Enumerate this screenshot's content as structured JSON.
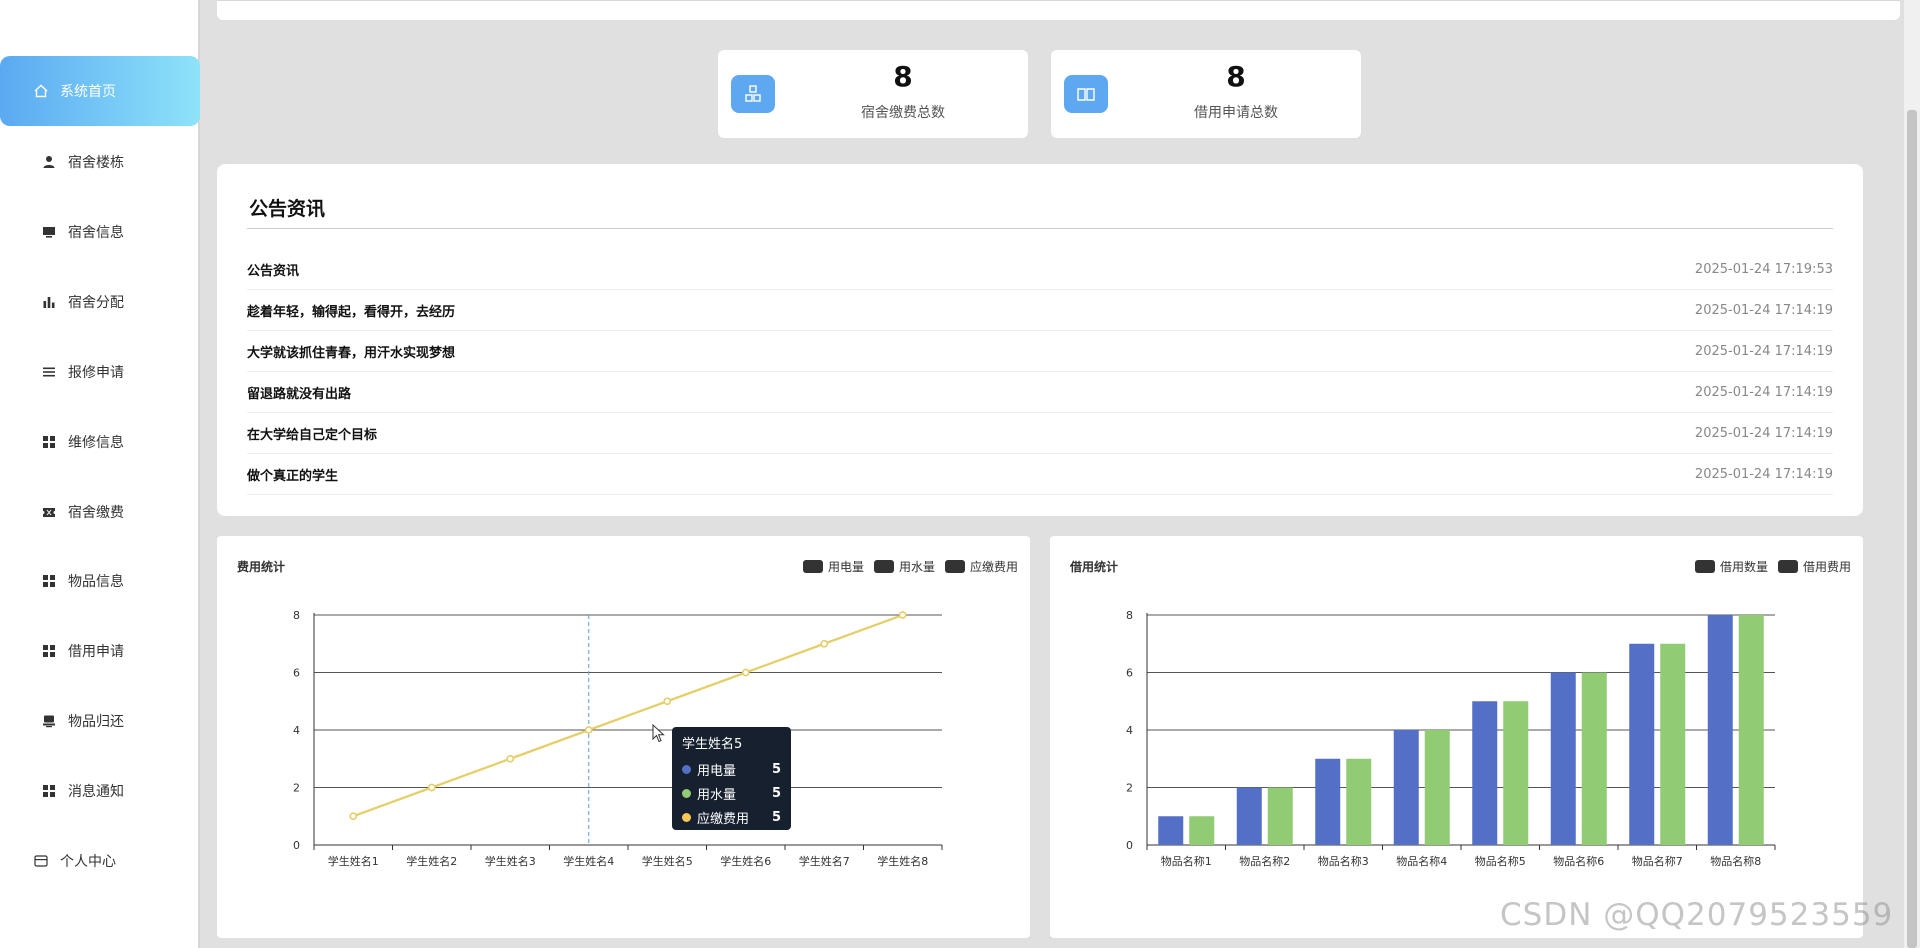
{
  "sidebar": {
    "items": [
      {
        "label": "系统首页",
        "icon": "home-icon"
      },
      {
        "label": "宿舍楼栋",
        "icon": "user-icon"
      },
      {
        "label": "宿舍信息",
        "icon": "monitor-icon"
      },
      {
        "label": "宿舍分配",
        "icon": "bar-chart-icon"
      },
      {
        "label": "报修申请",
        "icon": "list-icon"
      },
      {
        "label": "维修信息",
        "icon": "grid-icon"
      },
      {
        "label": "宿舍缴费",
        "icon": "ticket-icon"
      },
      {
        "label": "物品信息",
        "icon": "grid-icon"
      },
      {
        "label": "借用申请",
        "icon": "grid-icon"
      },
      {
        "label": "物品归还",
        "icon": "printer-icon"
      },
      {
        "label": "消息通知",
        "icon": "grid-icon"
      },
      {
        "label": "个人中心",
        "icon": "card-icon"
      }
    ]
  },
  "stats": [
    {
      "value": "8",
      "label": "宿舍缴费总数",
      "icon": "building-blocks-icon"
    },
    {
      "value": "8",
      "label": "借用申请总数",
      "icon": "book-icon"
    }
  ],
  "notices": {
    "title": "公告资讯",
    "items": [
      {
        "text": "公告资讯",
        "time": "2025-01-24 17:19:53"
      },
      {
        "text": "趁着年轻，输得起，看得开，去经历",
        "time": "2025-01-24 17:14:19"
      },
      {
        "text": "大学就该抓住青春，用汗水实现梦想",
        "time": "2025-01-24 17:14:19"
      },
      {
        "text": "留退路就没有出路",
        "time": "2025-01-24 17:14:19"
      },
      {
        "text": "在大学给自己定个目标",
        "time": "2025-01-24 17:14:19"
      },
      {
        "text": "做个真正的学生",
        "time": "2025-01-24 17:14:19"
      }
    ]
  },
  "colors": {
    "accent": "#5ea8f2",
    "series_blue": "#5470c6",
    "series_green": "#91cc75",
    "series_yellow": "#fac858",
    "tooltip_bg": "#16202f"
  },
  "chart_data": [
    {
      "type": "line",
      "title": "费用统计",
      "legend": [
        "用电量",
        "用水量",
        "应缴费用"
      ],
      "legend_position": "top-right",
      "categories": [
        "学生姓名1",
        "学生姓名2",
        "学生姓名3",
        "学生姓名4",
        "学生姓名5",
        "学生姓名6",
        "学生姓名7",
        "学生姓名8"
      ],
      "series": [
        {
          "name": "用电量",
          "values": [
            1,
            2,
            3,
            4,
            5,
            6,
            7,
            8
          ]
        },
        {
          "name": "用水量",
          "values": [
            1,
            2,
            3,
            4,
            5,
            6,
            7,
            8
          ]
        },
        {
          "name": "应缴费用",
          "values": [
            1,
            2,
            3,
            4,
            5,
            6,
            7,
            8
          ]
        }
      ],
      "ylim": [
        0,
        8
      ],
      "yticks": [
        "0",
        "2",
        "4",
        "6",
        "8"
      ],
      "grid": true,
      "tooltip": {
        "title": "学生姓名5",
        "rows": [
          {
            "name": "用电量",
            "value": "5"
          },
          {
            "name": "用水量",
            "value": "5"
          },
          {
            "name": "应缴费用",
            "value": "5"
          }
        ]
      }
    },
    {
      "type": "bar",
      "title": "借用统计",
      "legend": [
        "借用数量",
        "借用费用"
      ],
      "legend_position": "top-right",
      "categories": [
        "物品名称1",
        "物品名称2",
        "物品名称3",
        "物品名称4",
        "物品名称5",
        "物品名称6",
        "物品名称7",
        "物品名称8"
      ],
      "series": [
        {
          "name": "借用数量",
          "values": [
            1,
            2,
            3,
            4,
            5,
            6,
            7,
            8
          ]
        },
        {
          "name": "借用费用",
          "values": [
            1,
            2,
            3,
            4,
            5,
            6,
            7,
            8
          ]
        }
      ],
      "ylim": [
        0,
        8
      ],
      "yticks": [
        "0",
        "2",
        "4",
        "6",
        "8"
      ],
      "grid": true
    }
  ],
  "watermark": "CSDN @QQ2079523559"
}
